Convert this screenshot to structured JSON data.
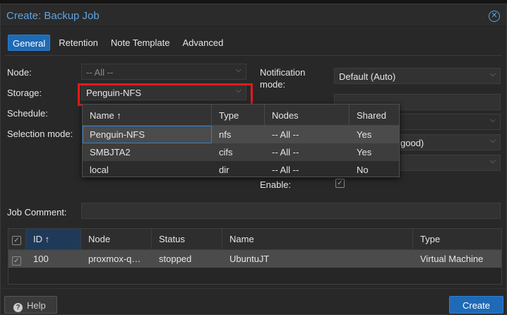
{
  "window": {
    "title": "Create: Backup Job"
  },
  "tabs": [
    {
      "label": "General",
      "active": true
    },
    {
      "label": "Retention"
    },
    {
      "label": "Note Template"
    },
    {
      "label": "Advanced"
    }
  ],
  "form": {
    "node_label": "Node:",
    "node_value": "-- All --",
    "storage_label": "Storage:",
    "storage_value": "Penguin-NFS",
    "schedule_label": "Schedule:",
    "selection_label": "Selection mode:",
    "notification_label_1": "Notification",
    "notification_label_2": "mode:",
    "notification_value": "Default (Auto)",
    "compression_partial": "good)",
    "enable_label": "Enable:",
    "enable_checked": true,
    "job_comment_label": "Job Comment:",
    "job_comment_value": ""
  },
  "storage_dropdown": {
    "columns": [
      "Name ↑",
      "Type",
      "Nodes",
      "Shared"
    ],
    "rows": [
      {
        "name": "Penguin-NFS",
        "type": "nfs",
        "nodes": "-- All --",
        "shared": "Yes"
      },
      {
        "name": "SMBJTA2",
        "type": "cifs",
        "nodes": "-- All --",
        "shared": "Yes"
      },
      {
        "name": "local",
        "type": "dir",
        "nodes": "-- All --",
        "shared": "No"
      }
    ]
  },
  "guest_grid": {
    "columns": [
      "ID ↑",
      "Node",
      "Status",
      "Name",
      "Type"
    ],
    "rows": [
      {
        "id": "100",
        "node": "proxmox-q…",
        "status": "stopped",
        "name": "UbuntuJT",
        "type": "Virtual Machine"
      }
    ]
  },
  "footer": {
    "help_label": "Help",
    "create_label": "Create"
  },
  "colors": {
    "accent": "#1e6ab6",
    "title": "#5fa3e0",
    "highlight": "#e21b1b"
  }
}
